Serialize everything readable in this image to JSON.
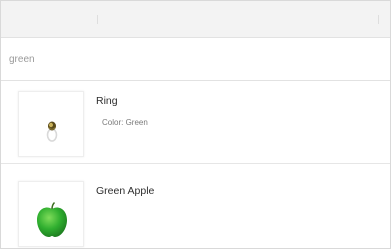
{
  "search": {
    "value": "green",
    "placeholder": "green"
  },
  "results": [
    {
      "title": "Ring",
      "meta": "Color: Green",
      "thumbnail_icon": "ring-thumbnail"
    },
    {
      "title": "Green Apple",
      "meta": "",
      "thumbnail_icon": "green-apple-thumbnail"
    }
  ],
  "colors": {
    "top_bar": "#f3f3f3",
    "border": "#e2e2e2",
    "title_text": "#2e2e2e",
    "meta_text": "#7a7a7a",
    "apple_green": "#2fae2f"
  }
}
